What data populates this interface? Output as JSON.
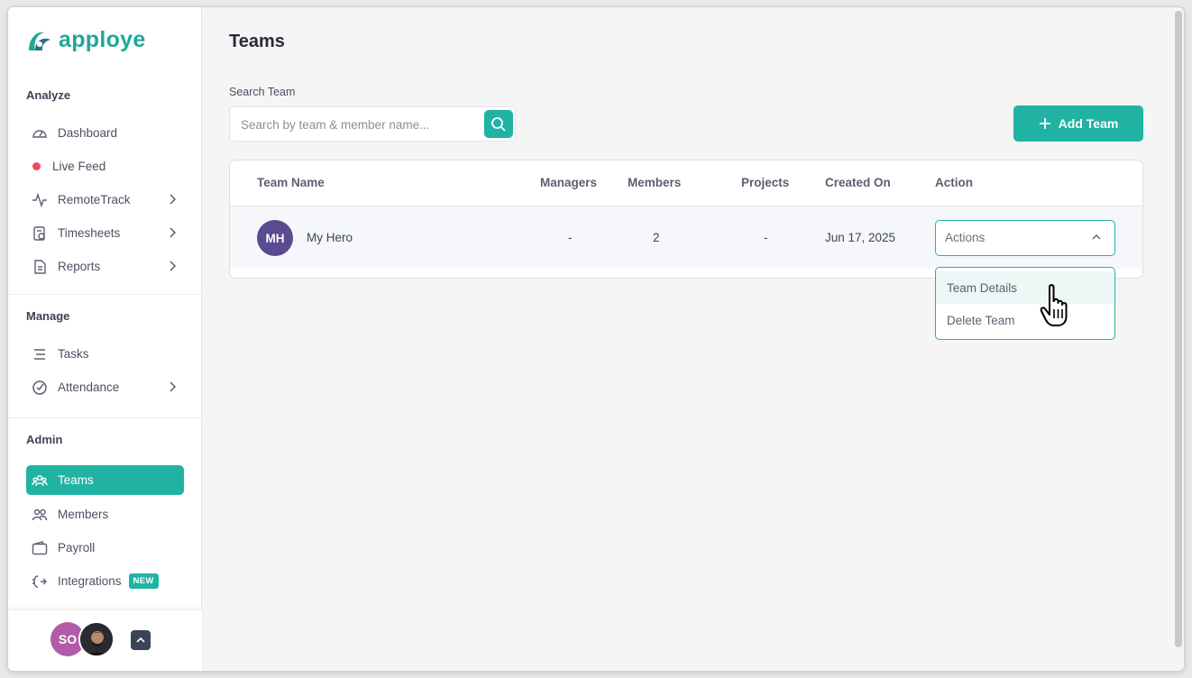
{
  "brand": {
    "name": "apploye",
    "color": "#1fa89a"
  },
  "sidebar": {
    "sections": [
      {
        "title": "Analyze"
      },
      {
        "title": "Manage"
      },
      {
        "title": "Admin"
      }
    ],
    "items": [
      {
        "label": "Dashboard",
        "icon": "dashboard-icon"
      },
      {
        "label": "Live Feed",
        "icon": "live-dot"
      },
      {
        "label": "RemoteTrack",
        "icon": "pulse-icon"
      },
      {
        "label": "Timesheets",
        "icon": "timesheet-icon"
      },
      {
        "label": "Reports",
        "icon": "report-icon"
      },
      {
        "label": "Tasks",
        "icon": "tasks-icon"
      },
      {
        "label": "Attendance",
        "icon": "attendance-icon"
      },
      {
        "label": "Teams",
        "icon": "teams-icon"
      },
      {
        "label": "Members",
        "icon": "members-icon"
      },
      {
        "label": "Payroll",
        "icon": "wallet-icon"
      },
      {
        "label": "Integrations",
        "icon": "integrations-icon",
        "badge": "NEW"
      }
    ],
    "user": {
      "initials": "SO"
    }
  },
  "main": {
    "title": "Teams",
    "search": {
      "label": "Search Team",
      "placeholder": "Search by team & member name..."
    },
    "add_button": "Add Team",
    "table": {
      "headers": [
        "Team Name",
        "Managers",
        "Members",
        "Projects",
        "Created On",
        "Action"
      ],
      "rows": [
        {
          "initials": "MH",
          "name": "My Hero",
          "managers": "-",
          "members": "2",
          "projects": "-",
          "created": "Jun 17, 2025",
          "action": "Actions"
        }
      ]
    },
    "dropdown": {
      "items": [
        "Team Details",
        "Delete Team"
      ]
    }
  },
  "colors": {
    "accent": "#20b3a4",
    "live": "#ee4c5c",
    "team_avatar": "#5a4a8f",
    "user_avatar": "#b25ba8"
  }
}
